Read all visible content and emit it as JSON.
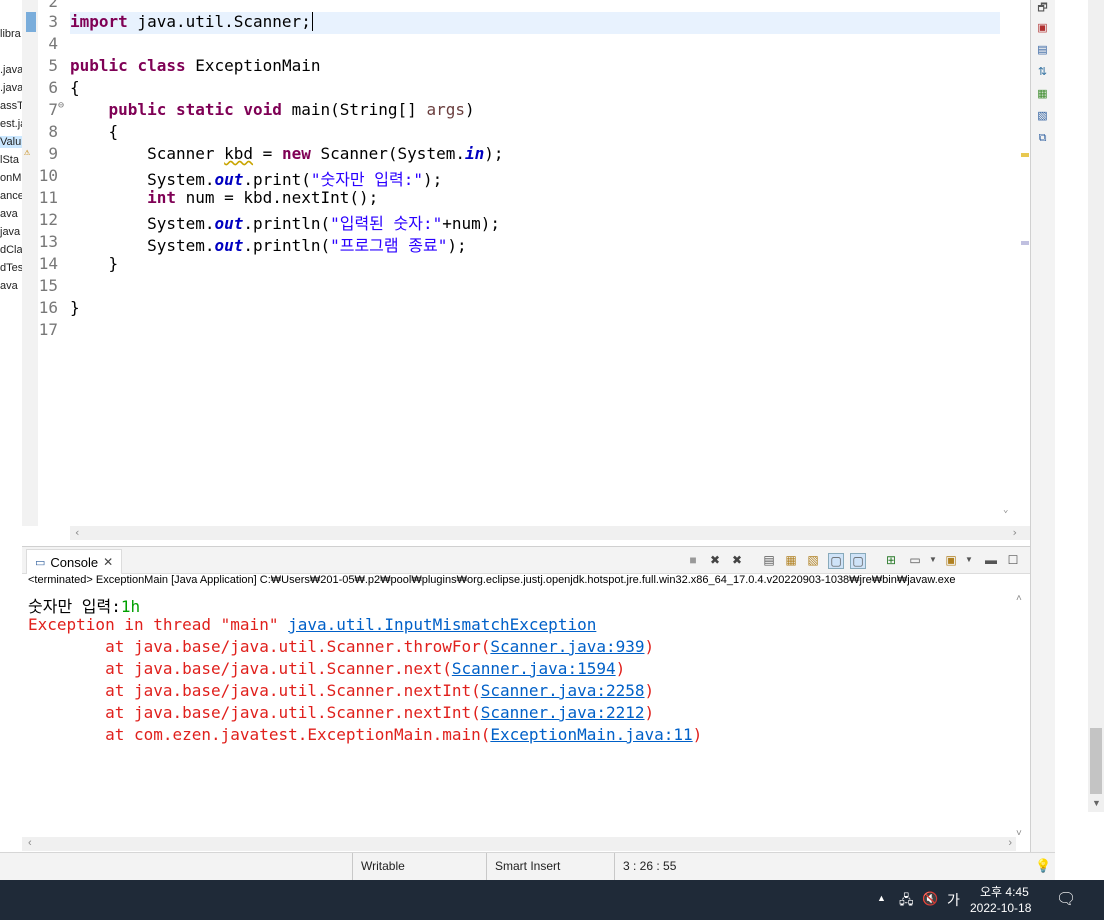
{
  "explorer": {
    "items": [
      "libra",
      ".java",
      ".java",
      "assTe",
      "est.ja",
      "Valu",
      "lSta",
      "onM",
      "ance",
      "ava",
      "java",
      "dCla",
      "dTes",
      "ava"
    ]
  },
  "editor": {
    "line_numbers": [
      "2",
      "3",
      "4",
      "5",
      "6",
      "7",
      "8",
      "9",
      "10",
      "11",
      "12",
      "13",
      "14",
      "15",
      "16",
      "17"
    ],
    "lines": {
      "l3": {
        "kw": "import",
        "rest": " java.util.Scanner;"
      },
      "l5": {
        "kw1": "public",
        "kw2": "class",
        "rest": " ExceptionMain"
      },
      "l6": "{",
      "l7": {
        "indent": "    ",
        "kw1": "public",
        "kw2": "static",
        "kw3": "void",
        "name": " main(String[] ",
        "param": "args",
        "end": ")"
      },
      "l8": "    {",
      "l9": {
        "a": "        Scanner ",
        "var": "kbd",
        "b": " = ",
        "kw": "new",
        "c": " Scanner(System.",
        "fld": "in",
        "d": ");"
      },
      "l10": {
        "a": "        System.",
        "fld": "out",
        "b": ".print(",
        "str": "\"숫자만 입력:\"",
        "c": ");"
      },
      "l11": {
        "a": "        ",
        "kw": "int",
        "b": " num = kbd.nextInt();"
      },
      "l12": {
        "a": "        System.",
        "fld": "out",
        "b": ".println(",
        "str": "\"입력된 숫자:\"",
        "c": "+num);"
      },
      "l13": {
        "a": "        System.",
        "fld": "out",
        "b": ".println(",
        "str": "\"프로그램 종료\"",
        "c": ");"
      },
      "l14": "    }",
      "l16": "}"
    }
  },
  "console": {
    "tab_label": "Console",
    "info": "<terminated> ExceptionMain [Java Application] C:₩Users₩201-05₩.p2₩pool₩plugins₩org.eclipse.justj.openjdk.hotspot.jre.full.win32.x86_64_17.0.4.v20220903-1038₩jre₩bin₩javaw.exe",
    "prompt": "숫자만 입력:",
    "user_input": "1h",
    "exception_prefix": "Exception in thread \"main\" ",
    "exception_class": "java.util.InputMismatchException",
    "trace": [
      {
        "method": "        at java.base/java.util.Scanner.throwFor(",
        "link": "Scanner.java:939",
        "end": ")"
      },
      {
        "method": "        at java.base/java.util.Scanner.next(",
        "link": "Scanner.java:1594",
        "end": ")"
      },
      {
        "method": "        at java.base/java.util.Scanner.nextInt(",
        "link": "Scanner.java:2258",
        "end": ")"
      },
      {
        "method": "        at java.base/java.util.Scanner.nextInt(",
        "link": "Scanner.java:2212",
        "end": ")"
      },
      {
        "method": "        at com.ezen.javatest.ExceptionMain.main(",
        "link": "ExceptionMain.java:11",
        "end": ")"
      }
    ]
  },
  "status_bar": {
    "writable": "Writable",
    "insert_mode": "Smart Insert",
    "position": "3 : 26 : 55"
  },
  "taskbar": {
    "ime": "가",
    "time": "오후 4:45",
    "date": "2022-10-18"
  },
  "colors": {
    "keyword": "#7f0055",
    "string": "#2a00ff",
    "field": "#0000c0",
    "error": "#e0201c",
    "link": "#0060c8",
    "input": "#00a000"
  }
}
